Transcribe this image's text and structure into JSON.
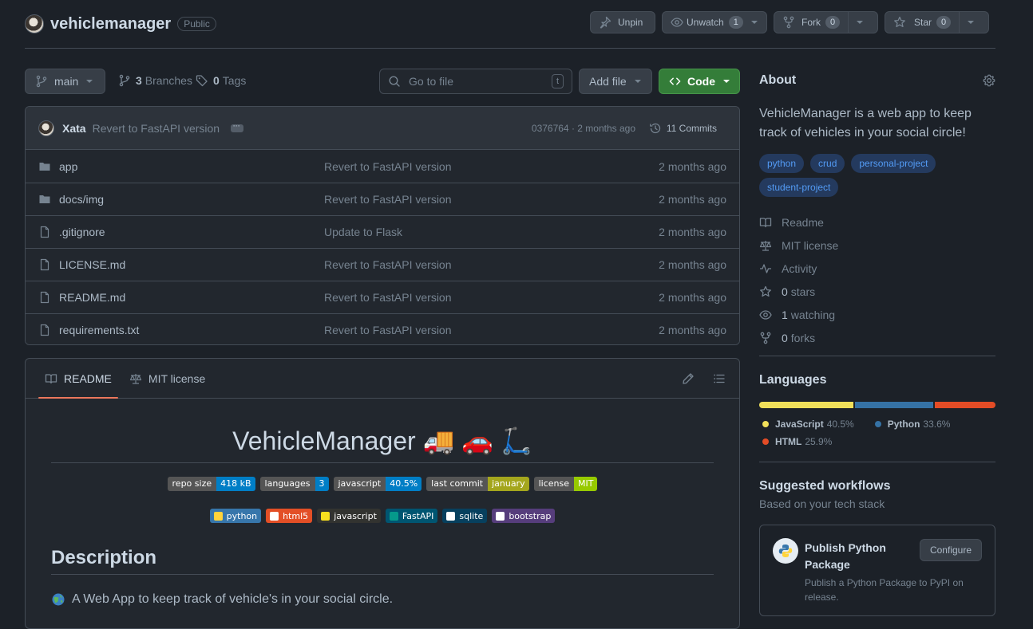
{
  "repo": {
    "name": "vehiclemanager",
    "visibility": "Public"
  },
  "header_buttons": {
    "unpin": "Unpin",
    "unwatch": "Unwatch",
    "unwatch_count": "1",
    "fork": "Fork",
    "fork_count": "0",
    "star": "Star",
    "star_count": "0"
  },
  "toolbar": {
    "branch": "main",
    "branches_count": "3",
    "branches_label": "Branches",
    "tags_count": "0",
    "tags_label": "Tags",
    "search_placeholder": "Go to file",
    "search_shortcut": "t",
    "add_file": "Add file",
    "code": "Code"
  },
  "latest_commit": {
    "author": "Xata",
    "message": "Revert to FastAPI version",
    "sha_time": "0376764 · 2 months ago",
    "commits_label": "11 Commits"
  },
  "files": [
    {
      "name": "app",
      "type": "folder",
      "message": "Revert to FastAPI version",
      "date": "2 months ago"
    },
    {
      "name": "docs/img",
      "type": "folder",
      "message": "Revert to FastAPI version",
      "date": "2 months ago"
    },
    {
      "name": ".gitignore",
      "type": "file",
      "message": "Update to Flask",
      "date": "2 months ago"
    },
    {
      "name": "LICENSE.md",
      "type": "file",
      "message": "Revert to FastAPI version",
      "date": "2 months ago"
    },
    {
      "name": "README.md",
      "type": "file",
      "message": "Revert to FastAPI version",
      "date": "2 months ago"
    },
    {
      "name": "requirements.txt",
      "type": "file",
      "message": "Revert to FastAPI version",
      "date": "2 months ago"
    }
  ],
  "readme": {
    "tabs": [
      "README",
      "MIT license"
    ],
    "title": "VehicleManager 🚚 🚗 🛴",
    "badges": [
      {
        "label": "repo size",
        "value": "418 kB",
        "color": "#007ec6"
      },
      {
        "label": "languages",
        "value": "3",
        "color": "#007ec6"
      },
      {
        "label": "javascript",
        "value": "40.5%",
        "color": "#007ec6"
      },
      {
        "label": "last commit",
        "value": "january",
        "color": "#a4a61d"
      },
      {
        "label": "license",
        "value": "MIT",
        "color": "#97ca00"
      }
    ],
    "tech": [
      {
        "label": "python",
        "color": "#3776ab",
        "icon": "python-icon",
        "icon_color": "#ffd43b"
      },
      {
        "label": "html5",
        "color": "#e34f26",
        "icon": "html5-icon",
        "icon_color": "#ffffff"
      },
      {
        "label": "javascript",
        "color": "#323330",
        "icon": "js-icon",
        "icon_color": "#f7df1e"
      },
      {
        "label": "FastAPI",
        "color": "#005571",
        "icon": "fastapi-icon",
        "icon_color": "#05998b"
      },
      {
        "label": "sqlite",
        "color": "#07405e",
        "icon": "sqlite-icon",
        "icon_color": "#ffffff"
      },
      {
        "label": "bootstrap",
        "color": "#563d7c",
        "icon": "bootstrap-icon",
        "icon_color": "#ffffff"
      }
    ],
    "section_heading": "Description",
    "description": "A Web App to keep track of vehicle's in your social circle."
  },
  "about": {
    "heading": "About",
    "description": "VehicleManager is a web app to keep track of vehicles in your social circle!",
    "topics": [
      "python",
      "crud",
      "personal-project",
      "student-project"
    ],
    "links": [
      {
        "icon": "book-icon",
        "count": "",
        "label": "Readme"
      },
      {
        "icon": "law-icon",
        "count": "",
        "label": "MIT license"
      },
      {
        "icon": "pulse-icon",
        "count": "",
        "label": "Activity"
      },
      {
        "icon": "star-icon",
        "count": "0",
        "label": "stars"
      },
      {
        "icon": "eye-icon",
        "count": "1",
        "label": "watching"
      },
      {
        "icon": "fork-icon",
        "count": "0",
        "label": "forks"
      }
    ]
  },
  "languages": {
    "heading": "Languages",
    "items": [
      {
        "name": "JavaScript",
        "percent": "40.5%",
        "value": 40.5,
        "color": "#f1e05a"
      },
      {
        "name": "Python",
        "percent": "33.6%",
        "value": 33.6,
        "color": "#3572a5"
      },
      {
        "name": "HTML",
        "percent": "25.9%",
        "value": 25.9,
        "color": "#e34c26"
      }
    ]
  },
  "workflows": {
    "heading": "Suggested workflows",
    "subheading": "Based on your tech stack",
    "card": {
      "title": "Publish Python Package",
      "button": "Configure",
      "description": "Publish a Python Package to PyPI on release."
    }
  }
}
